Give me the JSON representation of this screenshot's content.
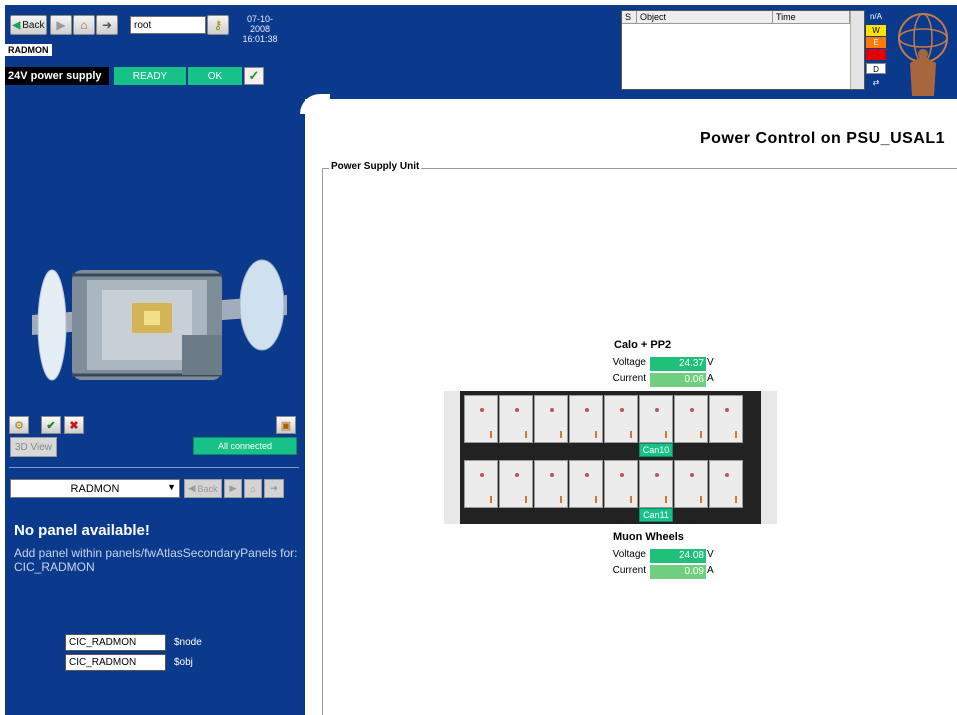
{
  "toolbar": {
    "back_label": "Back",
    "search_value": "root",
    "date": "07-10-2008",
    "time": "16:01:38",
    "system_name": "RADMON",
    "psu_label": "24V power supply",
    "state_ready": "READY",
    "state_ok": "OK",
    "check_glyph": "✓"
  },
  "alarm_table": {
    "columns": [
      "S",
      "Object",
      "Time"
    ],
    "severities": [
      "n/A",
      "W",
      "E",
      "F",
      "D",
      "⇄"
    ],
    "severity_colors": [
      "#0b3a8c",
      "#ffe400",
      "#ff7a00",
      "#e00000",
      "#ffffff",
      "#0b3a8c"
    ]
  },
  "left_panel": {
    "view3d_label": "3D View",
    "all_connected": "All connected",
    "selector_value": "RADMON",
    "nav_back": "Back",
    "no_panel_title": "No panel available!",
    "no_panel_desc": "Add panel within panels/fwAtlasSecondaryPanels for: CIC_RADMON",
    "node_value": "CIC_RADMON",
    "node_label": "$node",
    "obj_value": "CIC_RADMON",
    "obj_label": "$obj"
  },
  "main": {
    "title": "Power Control on PSU_USAL1",
    "frame_label": "Power Supply Unit",
    "group1": {
      "name": "Calo + PP2",
      "voltage_label": "Voltage",
      "voltage_value": "24.37",
      "voltage_unit": "V",
      "current_label": "Current",
      "current_value": "0.06",
      "current_unit": "A"
    },
    "group2": {
      "name": "Muon Wheels",
      "voltage_label": "Voltage",
      "voltage_value": "24.08",
      "voltage_unit": "V",
      "current_label": "Current",
      "current_value": "0.09",
      "current_unit": "A"
    },
    "can_top": "Can10",
    "can_bottom": "Can11"
  },
  "colors": {
    "panel_blue": "#0b3a8c",
    "ok_green": "#17c187",
    "value_green": "#1ec07a"
  }
}
